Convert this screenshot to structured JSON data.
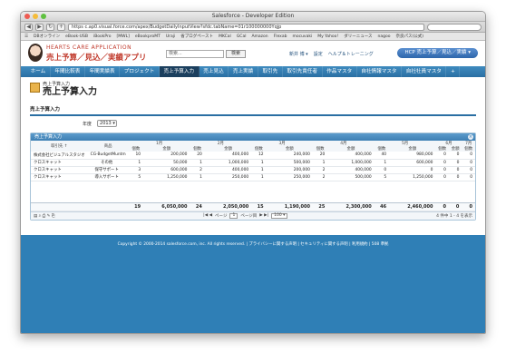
{
  "window": {
    "title": "Salesforce - Developer Edition"
  },
  "browser": {
    "url": "https c.ap0.visual.force.com/apex/BudgetDailyInputView?sfdc.tabName=01r100000000Yqjp",
    "bookmarks": [
      "DBオンライン",
      "eBook-USB",
      "iBookPro",
      "[MWL]",
      "eBookproMT",
      "Uraji",
      "省ブログペースト",
      "MKCal",
      "GCal",
      "Amazon",
      "Flexab",
      "mocuvaki",
      "My Yahoo!",
      "ダリーニュース",
      "nagoo",
      "奈良パス(公式)"
    ]
  },
  "header": {
    "logo_top": "HEARTS CARE APPLICATION",
    "logo_main": "売上予算／見込／実績アプリ",
    "search_placeholder": "検索...",
    "search_button": "検索",
    "user_link": "新井 博 ▾",
    "setup_link": "設定",
    "help_link": "ヘルプ＆トレーニング",
    "app_button": "HCP 売上予算／見込／実績 ▾"
  },
  "tabs": [
    {
      "label": "ホーム",
      "active": false
    },
    {
      "label": "年間比較表",
      "active": false
    },
    {
      "label": "年間実績表",
      "active": false
    },
    {
      "label": "プロジェクト",
      "active": false
    },
    {
      "label": "売上予算入力",
      "active": true
    },
    {
      "label": "売上見込",
      "active": false
    },
    {
      "label": "売上実績",
      "active": false
    },
    {
      "label": "取引先",
      "active": false
    },
    {
      "label": "取引先責任者",
      "active": false
    },
    {
      "label": "作品マスタ",
      "active": false
    },
    {
      "label": "自社情報マスタ",
      "active": false
    },
    {
      "label": "自社社員マスタ",
      "active": false
    },
    {
      "label": "+",
      "active": false
    }
  ],
  "page": {
    "small_title": "売上予算入力",
    "title": "売上予算入力",
    "section_title": "売上予算入力",
    "year_label": "年度",
    "year_value": "2013 ▾"
  },
  "panel": {
    "title": "売上予算入力",
    "columns": [
      "取引先 ↑",
      "商品",
      "1月",
      "2月",
      "3月",
      "4月",
      "5月",
      "6月",
      "7月"
    ],
    "subcols": [
      "個数",
      "金額"
    ],
    "rows": [
      [
        "株式会社ビジュアルスタジオ",
        "CG-BudgetMuntm",
        "10",
        "200,000",
        "20",
        "400,000",
        "12",
        "240,000",
        "20",
        "400,000",
        "40",
        "980,000",
        "0",
        "0",
        "0"
      ],
      [
        "クロスキャット",
        "その他",
        "1",
        "50,000",
        "1",
        "1,000,000",
        "1",
        "500,000",
        "1",
        "1,000,000",
        "1",
        "600,000",
        "0",
        "0",
        "0"
      ],
      [
        "クロスキャット",
        "保守サポート",
        "3",
        "600,000",
        "2",
        "400,000",
        "1",
        "200,000",
        "2",
        "400,000",
        "0",
        "0",
        "0",
        "0",
        "0"
      ],
      [
        "クロスキャット",
        "導入サポート",
        "5",
        "1,250,000",
        "1",
        "250,000",
        "1",
        "250,000",
        "2",
        "500,000",
        "5",
        "1,250,000",
        "0",
        "0",
        "0"
      ]
    ],
    "totals": [
      "19",
      "6,050,000",
      "24",
      "2,050,000",
      "15",
      "1,190,000",
      "25",
      "2,300,000",
      "46",
      "2,460,000",
      "0",
      "0",
      "0"
    ],
    "pager": {
      "page_prefix": "ページ",
      "page_value": "1",
      "page_suffix": "ページ目",
      "rows_value": "100 ▾",
      "count": "4 件中 1 - 4 を表示"
    }
  },
  "footer": {
    "text": "Copyright © 2000-2014 salesforce.com, inc. All rights reserved. | プライバシーに関する声明 | セキュリティに関する声明 | 利用規約 | 508 準拠"
  },
  "colors": {
    "tab_bar": "#2a6fa3",
    "active_tab": "#1b3f5e",
    "footer": "#2f7fb6",
    "accent_red": "#c0392b"
  }
}
